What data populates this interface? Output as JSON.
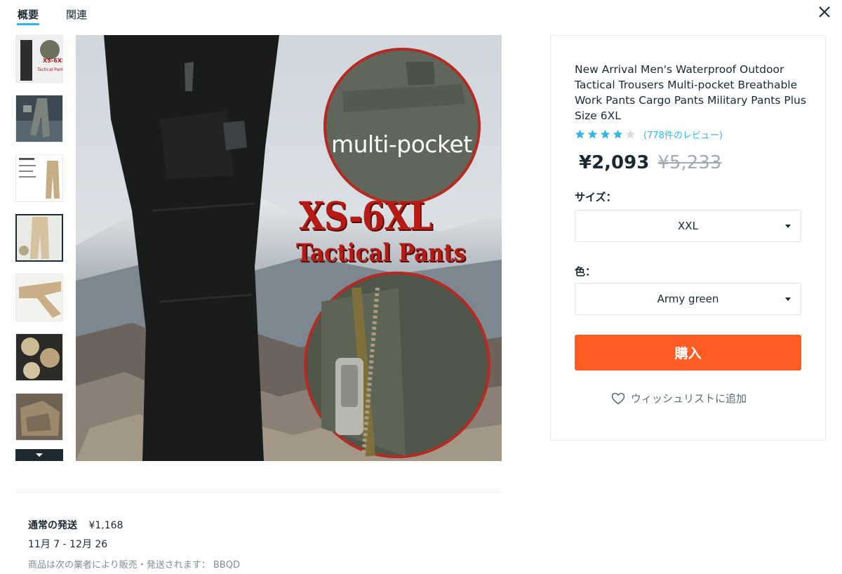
{
  "tabs": [
    {
      "label": "概要",
      "active": true
    },
    {
      "label": "関連",
      "active": false
    }
  ],
  "product": {
    "title": "New Arrival Men's Waterproof Outdoor Tactical Trousers Multi-pocket Breathable Work Pants Cargo Pants Military Pants Plus Size 6XL",
    "rating": 4,
    "rating_max": 5,
    "review_text": "(778件のレビュー)",
    "price": "¥2,093",
    "original_price": "¥5,233",
    "size_label": "サイズ：",
    "size_value": "XXL",
    "color_label": "色：",
    "color_value": "Army green",
    "buy_label": "購入",
    "wishlist_label": "ウィッシュリストに追加"
  },
  "image_overlay": {
    "multi_pocket": "multi-pocket",
    "size_range": "XS-6XL",
    "name": "Tactical Pants"
  },
  "shipping": {
    "label": "通常の発送",
    "cost": "¥1,168",
    "dates": "11月 7 - 12月 26",
    "seller": "商品は次の業者により販売・発送されます： BBQD"
  },
  "thumbnails": [
    {
      "name": "thumbnail-1",
      "selected": false
    },
    {
      "name": "thumbnail-2",
      "selected": false
    },
    {
      "name": "thumbnail-3",
      "selected": false
    },
    {
      "name": "thumbnail-4",
      "selected": true
    },
    {
      "name": "thumbnail-5",
      "selected": false
    },
    {
      "name": "thumbnail-6",
      "selected": false
    },
    {
      "name": "thumbnail-7",
      "selected": false
    }
  ],
  "colors": {
    "accent": "#2fb7ec",
    "buy": "#ff5c23",
    "star": "#2fb7ec",
    "star_empty": "#d7dde1"
  },
  "icons": {
    "close": "close-icon",
    "heart": "heart-icon",
    "scroll_down": "chevron-down-icon"
  }
}
